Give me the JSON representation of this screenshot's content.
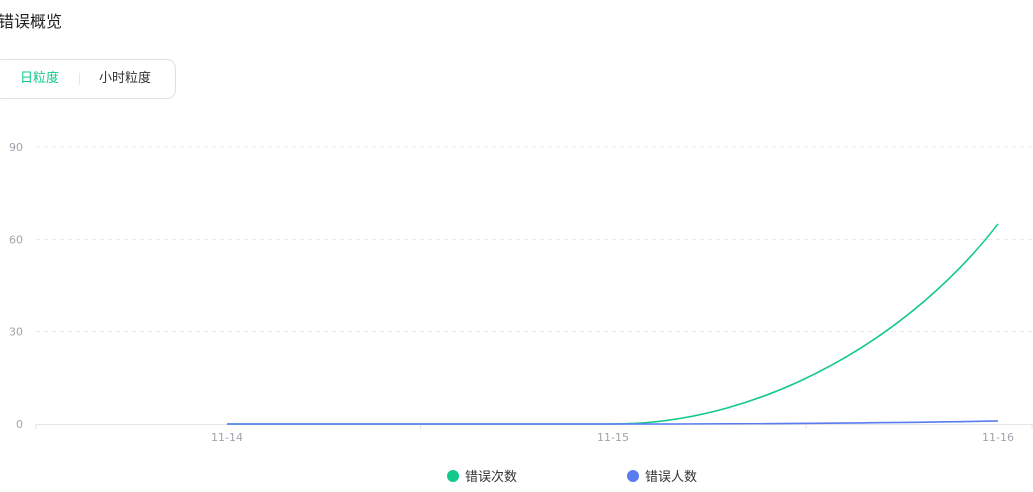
{
  "page": {
    "title": "错误概览"
  },
  "granularity": {
    "options": [
      "日粒度",
      "小时粒度"
    ],
    "selected": "日粒度"
  },
  "colors": {
    "accent": "#0fc98b",
    "series_error_count": "#12c98a",
    "series_error_users": "#5b7cf0"
  },
  "chart_data": {
    "type": "line",
    "categories": [
      "11-14",
      "11-15",
      "11-16"
    ],
    "y_ticks": [
      0,
      30,
      60,
      90
    ],
    "ylim": [
      0,
      90
    ],
    "grid": true,
    "legend_position": "bottom",
    "smooth": true,
    "series": [
      {
        "name": "错误次数",
        "values": [
          0,
          0,
          65
        ],
        "color": "#12c98a"
      },
      {
        "name": "错误人数",
        "values": [
          0,
          0,
          1
        ],
        "color": "#5b7cf0"
      }
    ]
  }
}
